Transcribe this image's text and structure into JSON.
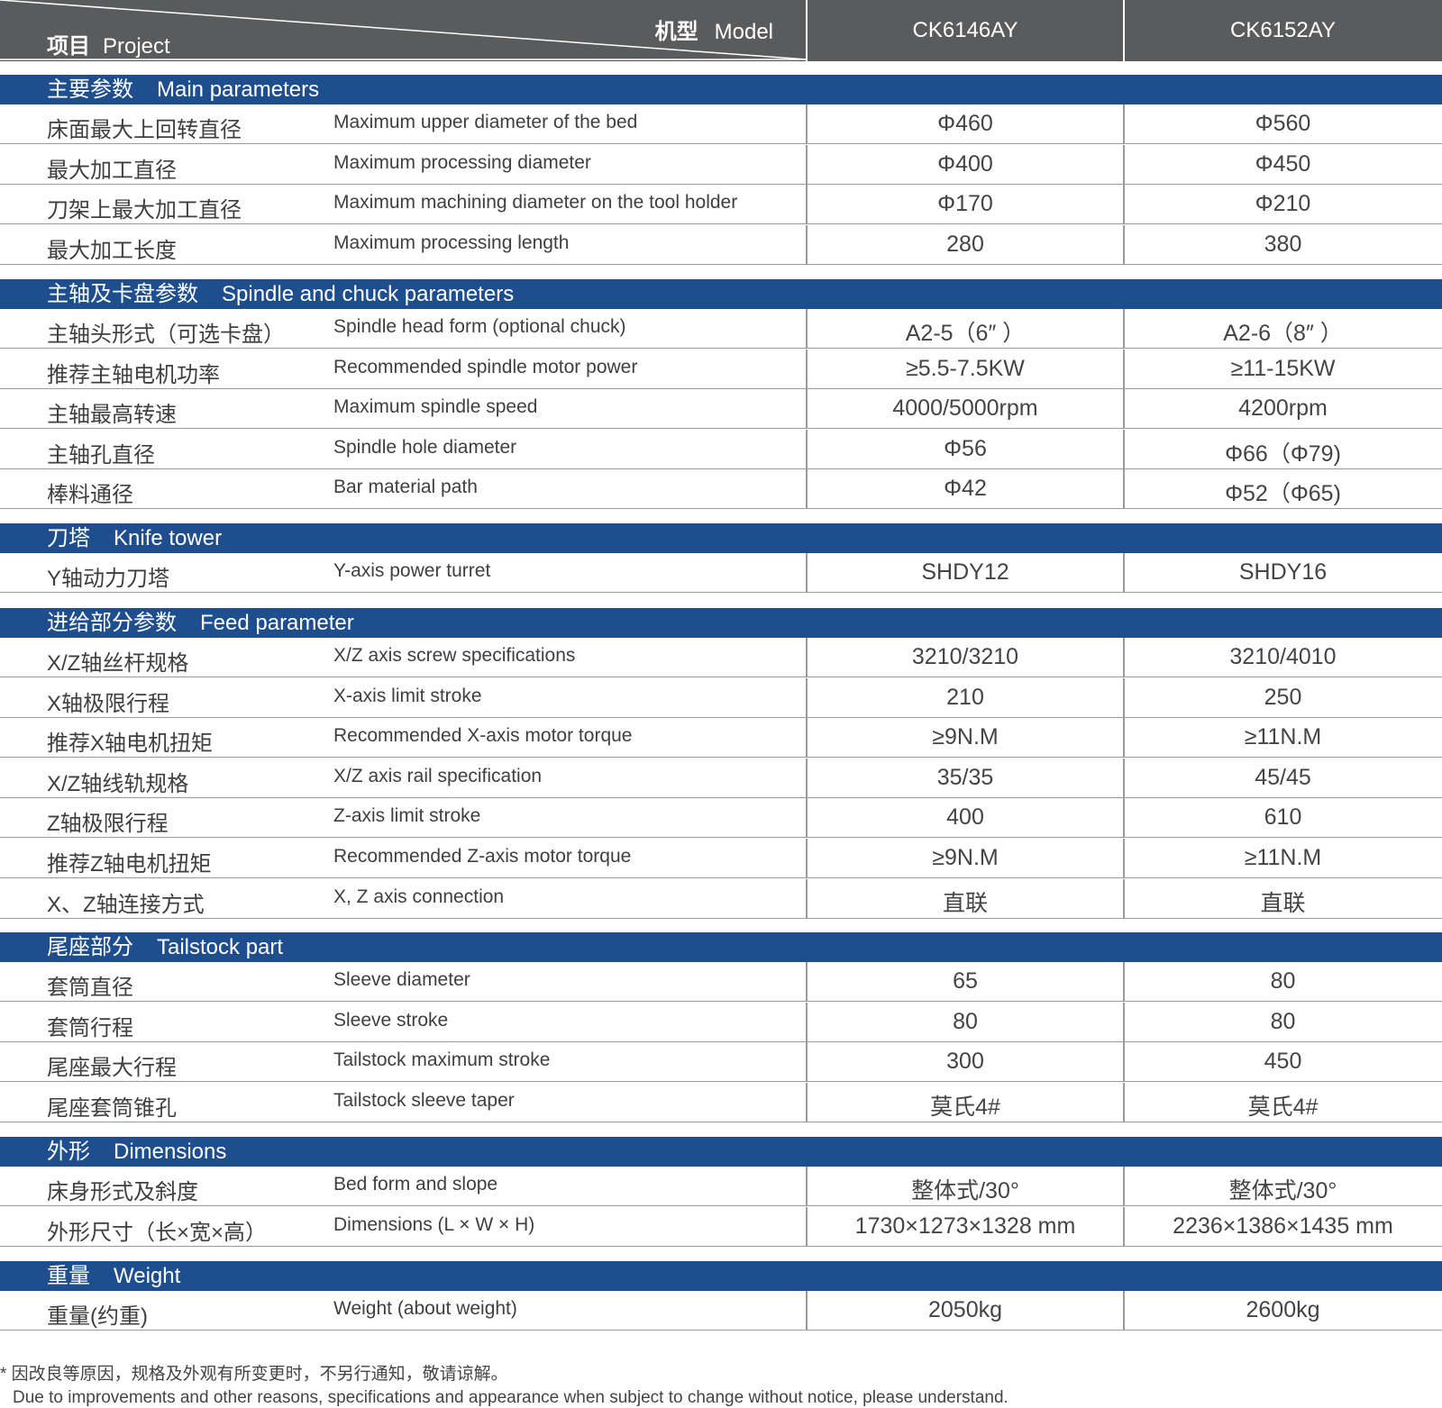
{
  "header": {
    "project_cn": "项目",
    "project_en": "Project",
    "model_cn": "机型",
    "model_en": "Model",
    "models": [
      "CK6146AY",
      "CK6152AY"
    ]
  },
  "colors": {
    "header_bg": "#595b5d",
    "section_bg": "#1f4e8e",
    "divider": "#9a9a9a"
  },
  "sections": [
    {
      "cn": "主要参数",
      "en": "Main parameters",
      "rows": [
        {
          "cn": "床面最大上回转直径",
          "en": "Maximum upper diameter of the bed",
          "v1": "Φ460",
          "v2": "Φ560"
        },
        {
          "cn": "最大加工直径",
          "en": "Maximum processing diameter",
          "v1": "Φ400",
          "v2": "Φ450"
        },
        {
          "cn": "刀架上最大加工直径",
          "en": "Maximum machining diameter on the tool holder",
          "v1": "Φ170",
          "v2": "Φ210"
        },
        {
          "cn": "最大加工长度",
          "en": "Maximum processing length",
          "v1": "280",
          "v2": "380"
        }
      ]
    },
    {
      "cn": "主轴及卡盘参数",
      "en": "Spindle and chuck parameters",
      "rows": [
        {
          "cn": "主轴头形式（可选卡盘）",
          "en": "Spindle head form (optional chuck)",
          "v1": "A2-5（6″ ）",
          "v2": "A2-6（8″ ）"
        },
        {
          "cn": "推荐主轴电机功率",
          "en": "Recommended spindle motor power",
          "v1": "≥5.5-7.5KW",
          "v2": "≥11-15KW"
        },
        {
          "cn": "主轴最高转速",
          "en": "Maximum spindle speed",
          "v1": "4000/5000rpm",
          "v2": "4200rpm"
        },
        {
          "cn": "主轴孔直径",
          "en": "Spindle hole diameter",
          "v1": "Φ56",
          "v2": "Φ66（Φ79)"
        },
        {
          "cn": "棒料通径",
          "en": "Bar material path",
          "v1": "Φ42",
          "v2": "Φ52（Φ65)"
        }
      ]
    },
    {
      "cn": "刀塔",
      "en": "Knife tower",
      "rows": [
        {
          "cn": "Y轴动力刀塔",
          "en": "Y-axis power turret",
          "v1": "SHDY12",
          "v2": "SHDY16"
        }
      ]
    },
    {
      "cn": "进给部分参数",
      "en": "Feed parameter",
      "rows": [
        {
          "cn": "X/Z轴丝杆规格",
          "en": "X/Z axis screw specifications",
          "v1": "3210/3210",
          "v2": "3210/4010"
        },
        {
          "cn": "X轴极限行程",
          "en": "X-axis limit stroke",
          "v1": "210",
          "v2": "250"
        },
        {
          "cn": "推荐X轴电机扭矩",
          "en": "Recommended X-axis motor torque",
          "v1": "≥9N.M",
          "v2": "≥11N.M"
        },
        {
          "cn": "X/Z轴线轨规格",
          "en": "X/Z axis rail specification",
          "v1": "35/35",
          "v2": "45/45"
        },
        {
          "cn": "Z轴极限行程",
          "en": "Z-axis limit stroke",
          "v1": "400",
          "v2": "610"
        },
        {
          "cn": "推荐Z轴电机扭矩",
          "en": "Recommended Z-axis motor torque",
          "v1": "≥9N.M",
          "v2": "≥11N.M"
        },
        {
          "cn": "X、Z轴连接方式",
          "en": "X, Z axis connection",
          "v1": "直联",
          "v2": "直联"
        }
      ]
    },
    {
      "cn": "尾座部分",
      "en": "Tailstock part",
      "rows": [
        {
          "cn": "套筒直径",
          "en": "Sleeve diameter",
          "v1": "65",
          "v2": "80"
        },
        {
          "cn": "套筒行程",
          "en": "Sleeve stroke",
          "v1": "80",
          "v2": "80"
        },
        {
          "cn": "尾座最大行程",
          "en": "Tailstock maximum stroke",
          "v1": "300",
          "v2": "450"
        },
        {
          "cn": "尾座套筒锥孔",
          "en": "Tailstock sleeve taper",
          "v1": "莫氏4#",
          "v2": "莫氏4#"
        }
      ]
    },
    {
      "cn": "外形",
      "en": "Dimensions",
      "rows": [
        {
          "cn": "床身形式及斜度",
          "en": "Bed form and slope",
          "v1": "整体式/30°",
          "v2": "整体式/30°"
        },
        {
          "cn": "外形尺寸（长×宽×高）",
          "en": "Dimensions (L × W × H)",
          "v1": "1730×1273×1328 mm",
          "v2": "2236×1386×1435 mm"
        }
      ]
    },
    {
      "cn": "重量",
      "en": "Weight",
      "rows": [
        {
          "cn": "重量(约重)",
          "en": "Weight (about weight)",
          "v1": "2050kg",
          "v2": "2600kg"
        }
      ]
    }
  ],
  "notes": {
    "cn": "* 因改良等原因，规格及外观有所变更时，不另行通知，敬请谅解。",
    "en": "Due to improvements and other reasons, specifications and appearance when subject to change without notice, please understand."
  }
}
